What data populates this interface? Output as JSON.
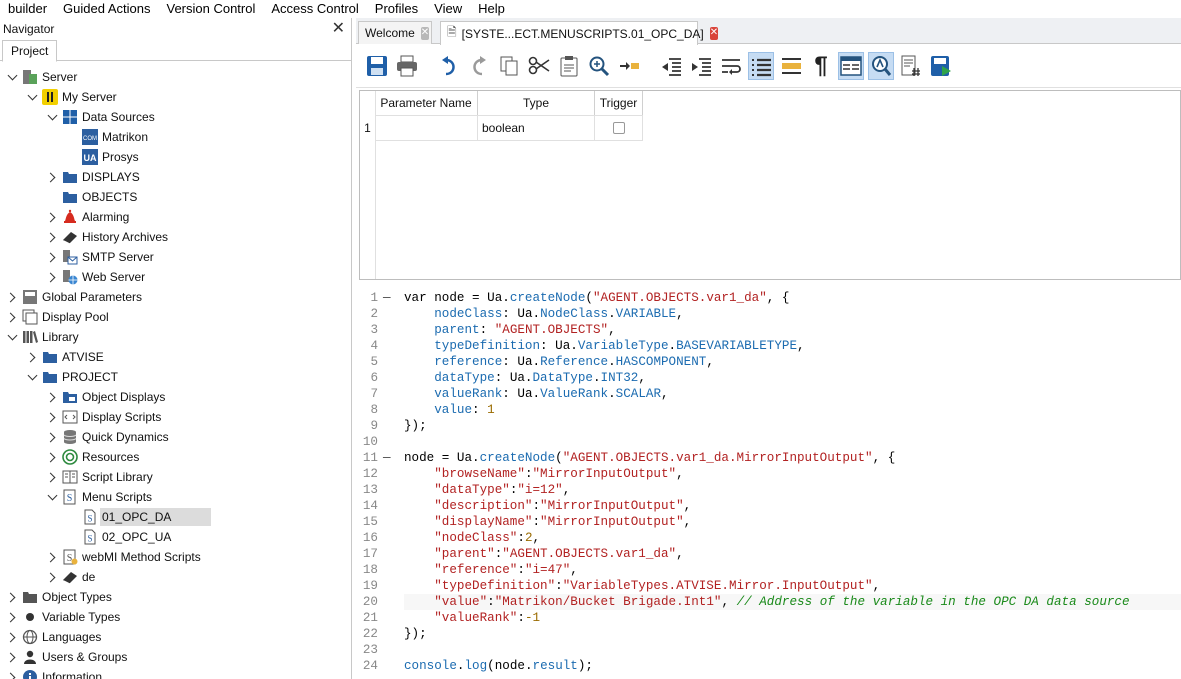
{
  "menu": [
    "builder",
    "Guided Actions",
    "Version Control",
    "Access Control",
    "Profiles",
    "View",
    "Help"
  ],
  "navigator": {
    "title": "Navigator",
    "tab": "Project",
    "tree": [
      {
        "label": "Server",
        "depth": 0,
        "arrow": "down",
        "icon": "server-icon"
      },
      {
        "label": "My Server",
        "depth": 1,
        "arrow": "down",
        "icon": "my-server-icon"
      },
      {
        "label": "Data Sources",
        "depth": 2,
        "arrow": "down",
        "icon": "data-sources-icon"
      },
      {
        "label": "Matrikon",
        "depth": 3,
        "arrow": "",
        "icon": "com-icon"
      },
      {
        "label": "Prosys",
        "depth": 3,
        "arrow": "",
        "icon": "ua-icon"
      },
      {
        "label": "DISPLAYS",
        "depth": 2,
        "arrow": "right",
        "icon": "folder-icon"
      },
      {
        "label": "OBJECTS",
        "depth": 2,
        "arrow": "",
        "icon": "folder-icon"
      },
      {
        "label": "Alarming",
        "depth": 2,
        "arrow": "right",
        "icon": "bell-icon"
      },
      {
        "label": "History Archives",
        "depth": 2,
        "arrow": "right",
        "icon": "book-icon"
      },
      {
        "label": "SMTP Server",
        "depth": 2,
        "arrow": "right",
        "icon": "mail-server-icon"
      },
      {
        "label": "Web Server",
        "depth": 2,
        "arrow": "right",
        "icon": "web-server-icon"
      },
      {
        "label": "Global Parameters",
        "depth": 0,
        "arrow": "right",
        "icon": "global-parameters-icon"
      },
      {
        "label": "Display Pool",
        "depth": 0,
        "arrow": "right",
        "icon": "display-pool-icon"
      },
      {
        "label": "Library",
        "depth": 0,
        "arrow": "down",
        "icon": "library-icon"
      },
      {
        "label": "ATVISE",
        "depth": 1,
        "arrow": "right",
        "icon": "folder-icon"
      },
      {
        "label": "PROJECT",
        "depth": 1,
        "arrow": "down",
        "icon": "folder-icon"
      },
      {
        "label": "Object Displays",
        "depth": 2,
        "arrow": "right",
        "icon": "object-displays-icon"
      },
      {
        "label": "Display Scripts",
        "depth": 2,
        "arrow": "right",
        "icon": "display-scripts-icon"
      },
      {
        "label": "Quick Dynamics",
        "depth": 2,
        "arrow": "right",
        "icon": "database-icon"
      },
      {
        "label": "Resources",
        "depth": 2,
        "arrow": "right",
        "icon": "resources-icon"
      },
      {
        "label": "Script Library",
        "depth": 2,
        "arrow": "right",
        "icon": "script-library-icon"
      },
      {
        "label": "Menu Scripts",
        "depth": 2,
        "arrow": "down",
        "icon": "menu-scripts-icon"
      },
      {
        "label": "01_OPC_DA",
        "depth": 3,
        "arrow": "",
        "icon": "script-file-icon",
        "selected": true
      },
      {
        "label": "02_OPC_UA",
        "depth": 3,
        "arrow": "",
        "icon": "script-file-icon"
      },
      {
        "label": "webMI Method Scripts",
        "depth": 2,
        "arrow": "right",
        "icon": "webmi-scripts-icon"
      },
      {
        "label": "de",
        "depth": 2,
        "arrow": "right",
        "icon": "book-icon"
      },
      {
        "label": "Object Types",
        "depth": 0,
        "arrow": "right",
        "icon": "object-types-icon"
      },
      {
        "label": "Variable Types",
        "depth": 0,
        "arrow": "right",
        "icon": "variable-types-icon"
      },
      {
        "label": "Languages",
        "depth": 0,
        "arrow": "right",
        "icon": "languages-icon"
      },
      {
        "label": "Users & Groups",
        "depth": 0,
        "arrow": "right",
        "icon": "users-icon"
      },
      {
        "label": "Information",
        "depth": 0,
        "arrow": "right",
        "icon": "info-icon"
      }
    ]
  },
  "editor": {
    "tabs": [
      {
        "label": "Welcome"
      },
      {
        "label": "[SYSTE...ECT.MENUSCRIPTS.01_OPC_DA]"
      }
    ],
    "params": {
      "headers": [
        "Parameter Name",
        "Type",
        "Trigger"
      ],
      "rows": [
        {
          "num": "1",
          "name": "",
          "type": "boolean",
          "trigger": false
        }
      ]
    },
    "code": [
      {
        "n": "1",
        "fold": "—",
        "t": [
          [
            "kw",
            "var node = Ua."
          ],
          [
            "m",
            "createNode"
          ],
          [
            "kw",
            "("
          ],
          [
            "s",
            "\"AGENT.OBJECTS.var1_da\""
          ],
          [
            "kw",
            ", {"
          ]
        ]
      },
      {
        "n": "2",
        "t": [
          [
            "kw",
            "    "
          ],
          [
            "m",
            "nodeClass"
          ],
          [
            "kw",
            ": Ua."
          ],
          [
            "m",
            "NodeClass"
          ],
          [
            "kw",
            "."
          ],
          [
            "m",
            "VARIABLE"
          ],
          [
            "kw",
            ","
          ]
        ]
      },
      {
        "n": "3",
        "t": [
          [
            "kw",
            "    "
          ],
          [
            "m",
            "parent"
          ],
          [
            "kw",
            ": "
          ],
          [
            "s",
            "\"AGENT.OBJECTS\""
          ],
          [
            "kw",
            ","
          ]
        ]
      },
      {
        "n": "4",
        "t": [
          [
            "kw",
            "    "
          ],
          [
            "m",
            "typeDefinition"
          ],
          [
            "kw",
            ": Ua."
          ],
          [
            "m",
            "VariableType"
          ],
          [
            "kw",
            "."
          ],
          [
            "m",
            "BASEVARIABLETYPE"
          ],
          [
            "kw",
            ","
          ]
        ]
      },
      {
        "n": "5",
        "t": [
          [
            "kw",
            "    "
          ],
          [
            "m",
            "reference"
          ],
          [
            "kw",
            ": Ua."
          ],
          [
            "m",
            "Reference"
          ],
          [
            "kw",
            "."
          ],
          [
            "m",
            "HASCOMPONENT"
          ],
          [
            "kw",
            ","
          ]
        ]
      },
      {
        "n": "6",
        "t": [
          [
            "kw",
            "    "
          ],
          [
            "m",
            "dataType"
          ],
          [
            "kw",
            ": Ua."
          ],
          [
            "m",
            "DataType"
          ],
          [
            "kw",
            "."
          ],
          [
            "m",
            "INT32"
          ],
          [
            "kw",
            ","
          ]
        ]
      },
      {
        "n": "7",
        "t": [
          [
            "kw",
            "    "
          ],
          [
            "m",
            "valueRank"
          ],
          [
            "kw",
            ": Ua."
          ],
          [
            "m",
            "ValueRank"
          ],
          [
            "kw",
            "."
          ],
          [
            "m",
            "SCALAR"
          ],
          [
            "kw",
            ","
          ]
        ]
      },
      {
        "n": "8",
        "t": [
          [
            "kw",
            "    "
          ],
          [
            "m",
            "value"
          ],
          [
            "kw",
            ": "
          ],
          [
            "n",
            "1"
          ]
        ]
      },
      {
        "n": "9",
        "t": [
          [
            "kw",
            "});"
          ]
        ]
      },
      {
        "n": "10",
        "t": [
          [
            "kw",
            ""
          ]
        ]
      },
      {
        "n": "11",
        "fold": "—",
        "t": [
          [
            "kw",
            "node = Ua."
          ],
          [
            "m",
            "createNode"
          ],
          [
            "kw",
            "("
          ],
          [
            "s",
            "\"AGENT.OBJECTS.var1_da.MirrorInputOutput\""
          ],
          [
            "kw",
            ", {"
          ]
        ]
      },
      {
        "n": "12",
        "t": [
          [
            "kw",
            "    "
          ],
          [
            "s",
            "\"browseName\""
          ],
          [
            "kw",
            ":"
          ],
          [
            "s",
            "\"MirrorInputOutput\""
          ],
          [
            "kw",
            ","
          ]
        ]
      },
      {
        "n": "13",
        "t": [
          [
            "kw",
            "    "
          ],
          [
            "s",
            "\"dataType\""
          ],
          [
            "kw",
            ":"
          ],
          [
            "s",
            "\"i=12\""
          ],
          [
            "kw",
            ","
          ]
        ]
      },
      {
        "n": "14",
        "t": [
          [
            "kw",
            "    "
          ],
          [
            "s",
            "\"description\""
          ],
          [
            "kw",
            ":"
          ],
          [
            "s",
            "\"MirrorInputOutput\""
          ],
          [
            "kw",
            ","
          ]
        ]
      },
      {
        "n": "15",
        "t": [
          [
            "kw",
            "    "
          ],
          [
            "s",
            "\"displayName\""
          ],
          [
            "kw",
            ":"
          ],
          [
            "s",
            "\"MirrorInputOutput\""
          ],
          [
            "kw",
            ","
          ]
        ]
      },
      {
        "n": "16",
        "t": [
          [
            "kw",
            "    "
          ],
          [
            "s",
            "\"nodeClass\""
          ],
          [
            "kw",
            ":"
          ],
          [
            "n",
            "2"
          ],
          [
            "kw",
            ","
          ]
        ]
      },
      {
        "n": "17",
        "t": [
          [
            "kw",
            "    "
          ],
          [
            "s",
            "\"parent\""
          ],
          [
            "kw",
            ":"
          ],
          [
            "s",
            "\"AGENT.OBJECTS.var1_da\""
          ],
          [
            "kw",
            ","
          ]
        ]
      },
      {
        "n": "18",
        "t": [
          [
            "kw",
            "    "
          ],
          [
            "s",
            "\"reference\""
          ],
          [
            "kw",
            ":"
          ],
          [
            "s",
            "\"i=47\""
          ],
          [
            "kw",
            ","
          ]
        ]
      },
      {
        "n": "19",
        "t": [
          [
            "kw",
            "    "
          ],
          [
            "s",
            "\"typeDefinition\""
          ],
          [
            "kw",
            ":"
          ],
          [
            "s",
            "\"VariableTypes.ATVISE.Mirror.InputOutput\""
          ],
          [
            "kw",
            ","
          ]
        ]
      },
      {
        "n": "20",
        "hl": true,
        "t": [
          [
            "kw",
            "    "
          ],
          [
            "s",
            "\"value\""
          ],
          [
            "kw",
            ":"
          ],
          [
            "s",
            "\"Matrikon/Bucket Brigade.Int1\""
          ],
          [
            "kw",
            ", "
          ],
          [
            "c",
            "// Address of the variable in the OPC DA data source"
          ]
        ]
      },
      {
        "n": "21",
        "t": [
          [
            "kw",
            "    "
          ],
          [
            "s",
            "\"valueRank\""
          ],
          [
            "kw",
            ":"
          ],
          [
            "n",
            "-1"
          ]
        ]
      },
      {
        "n": "22",
        "t": [
          [
            "kw",
            "});"
          ]
        ]
      },
      {
        "n": "23",
        "t": [
          [
            "kw",
            ""
          ]
        ]
      },
      {
        "n": "24",
        "t": [
          [
            "m",
            "console"
          ],
          [
            "kw",
            "."
          ],
          [
            "m",
            "log"
          ],
          [
            "kw",
            "(node."
          ],
          [
            "m",
            "result"
          ],
          [
            "kw",
            ");"
          ]
        ]
      }
    ]
  },
  "colors": {
    "accent": "#1f5fa8",
    "selection": "#dcdcdc",
    "toolbar_active": "#c6dcf3"
  }
}
